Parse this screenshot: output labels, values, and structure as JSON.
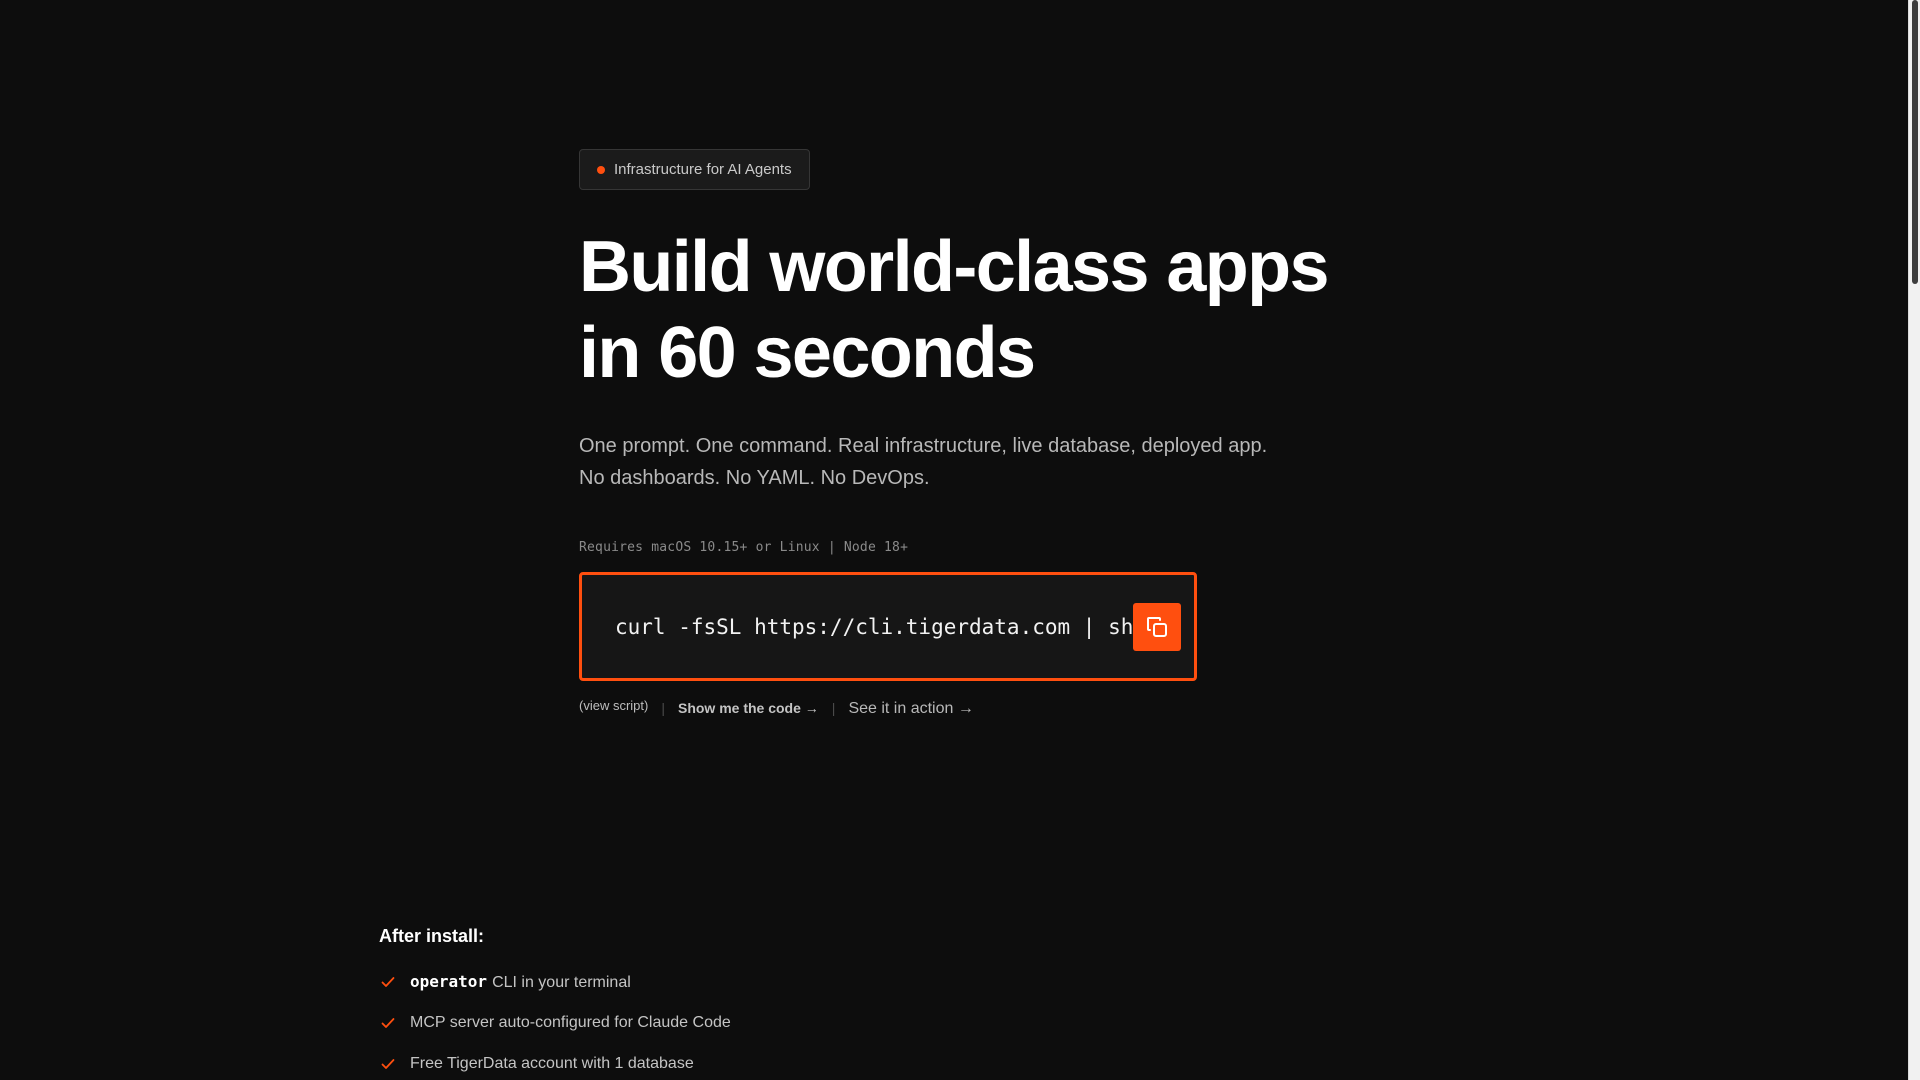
{
  "badge": {
    "label": "Infrastructure for AI Agents",
    "dot_color": "#ff4f0f"
  },
  "hero": {
    "headline_line1": "Build world-class apps",
    "headline_line2": "in 60 seconds",
    "subtitle_line1": "One prompt. One command. Real infrastructure, live database, deployed app.",
    "subtitle_line2": "No dashboards. No YAML. No DevOps."
  },
  "install": {
    "requirements": "Requires macOS 10.15+ or Linux | Node 18+",
    "command": "curl -fsSL https://cli.tigerdata.com | sh",
    "copy_icon": "copy-icon",
    "accent_color": "#ff4f0f"
  },
  "links": {
    "view_script": "(view script)",
    "separator": "|",
    "show_code": "Show me the code →",
    "see_action": "See it in action →"
  },
  "after_install": {
    "title": "After install:",
    "items": [
      {
        "code": "operator",
        "text": "CLI in your terminal"
      },
      {
        "text": "MCP server auto-configured for Claude Code"
      },
      {
        "text": "Free TigerData account with 1 database"
      }
    ],
    "check_icon": "check-icon"
  }
}
